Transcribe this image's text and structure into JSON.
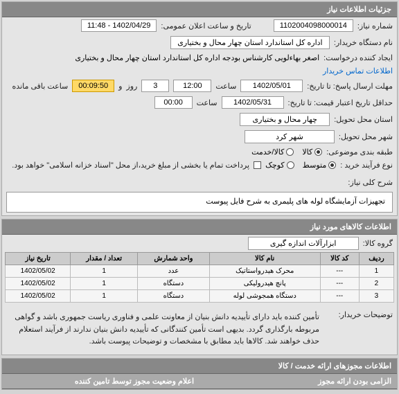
{
  "headers": {
    "need_details": "جزئیات اطلاعات نیاز",
    "need_items": "اطلاعات کالاهای مورد نیاز",
    "license_info": "اطلاعات مجوزهای ارائه خدمت / کالا"
  },
  "labels": {
    "need_no": "شماره نیاز:",
    "announce_datetime": "تاریخ و ساعت اعلان عمومی:",
    "buyer_org": "نام دستگاه خریدار:",
    "request_creator": "ایجاد کننده درخواست:",
    "buyer_contact": "اطلاعات تماس خریدار",
    "deadline": "مهلت ارسال پاسخ: تا تاریخ:",
    "hour": "ساعت",
    "and": "و",
    "day": "روز",
    "time_left": "ساعت باقی مانده",
    "validity_min": "حداقل تاریخ اعتبار قیمت: تا تاریخ:",
    "province": "استان محل تحویل:",
    "city": "شهر محل تحویل:",
    "subject_category": "طبقه بندی موضوعی:",
    "purchase_type": "نوع فرآیند خرید :",
    "partial_pay_note": "پرداخت تمام یا بخشی از مبلغ خرید،از محل \"اسناد خزانه اسلامی\" خواهد بود.",
    "need_desc": "شرح کلی نیاز:",
    "goods_group": "گروه کالا:",
    "buyer_notes": "توضیحات خریدار:",
    "licenses_needed": "الزامی بودن ارائه مجوز",
    "license_declare": "اعلام وضعیت مجوز توسط تامین کننده"
  },
  "values": {
    "need_no": "1102004098000014",
    "announce_datetime": "1402/04/29 - 11:48",
    "buyer_org": "اداره کل استاندارد استان چهار محال و بختیاری",
    "request_creator": "اصغر بهاءلویی  کارشناس بودجه اداره کل استاندارد استان چهار محال و بختیاری",
    "deadline_date": "1402/05/01",
    "deadline_hour": "12:00",
    "days_left": "3",
    "timer": "00:09:50",
    "validity_date": "1402/05/31",
    "validity_hour": "00:00",
    "province": "چهار محال و بختیاری",
    "city": "شهر کرد",
    "cat_goods": "کالا",
    "cat_service": "کالا/خدمت",
    "proc_medium": "متوسط",
    "proc_small": "کوچک",
    "need_desc": "تجهیزات آزمایشگاه لوله های پلیمری به شرح فایل پیوست",
    "goods_group": "ابزارآلات اندازه گیری",
    "buyer_notes": "تأمین کننده باید دارای تأییدیه دانش بنیان از معاونت علمی و فناوری ریاست جمهوری باشد و گواهی مربوطه بارگذاری گردد. بدیهی است تأمین کنندگانی که تأییدیه دانش بنیان ندارند از فرآیند استعلام حذف خواهند شد. کالاها باید مطابق با مشخصات و توضیحات پیوست باشد."
  },
  "table": {
    "headers": {
      "row": "ردیف",
      "code": "کد کالا",
      "name": "نام کالا",
      "unit": "واحد شمارش",
      "qty": "تعداد / مقدار",
      "date": "تاریخ نیاز"
    },
    "rows": [
      {
        "row": "1",
        "code": "---",
        "name": "محرک هیدرواستاتیک",
        "unit": "عدد",
        "qty": "1",
        "date": "1402/05/02"
      },
      {
        "row": "2",
        "code": "---",
        "name": "پانچ هیدرولیکی",
        "unit": "دستگاه",
        "qty": "1",
        "date": "1402/05/02"
      },
      {
        "row": "3",
        "code": "---",
        "name": "دستگاه همجوشی لوله",
        "unit": "دستگاه",
        "qty": "1",
        "date": "1402/05/02"
      }
    ]
  }
}
